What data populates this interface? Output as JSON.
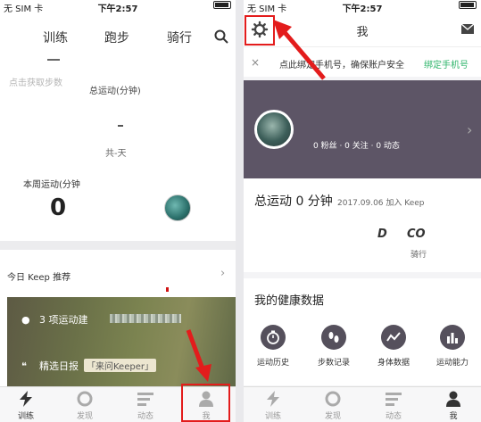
{
  "status_bar": {
    "carrier": "无 SIM 卡",
    "time": "下午2:57"
  },
  "left_screen": {
    "tabs": [
      "训练",
      "跑步",
      "骑行"
    ],
    "steps_button": "点击获取步数",
    "total_label": "总运动(分钟)",
    "days_label": "共-天",
    "week_label": "本周运动(分钟",
    "week_value": "0",
    "recommend_label": "今日 Keep 推荐",
    "banner_row1": "3 项运动建",
    "banner_row2_title": "精选日报",
    "banner_row2_chip": "「来问Keeper」",
    "tabbar": [
      "训练",
      "发现",
      "动态",
      "我"
    ]
  },
  "right_screen": {
    "title": "我",
    "notice_text": "点此绑定手机号，确保账户安全",
    "notice_link": "绑定手机号",
    "profile_stats": "0 粉丝  ·  0 关注  ·  0 动态",
    "total_sport": "总运动 0 分钟",
    "join_date": "2017.09.06 加入 Keep",
    "co_marks": [
      "D",
      "CO"
    ],
    "ride_label": "骑行",
    "health_title": "我的健康数据",
    "health_items": [
      "运动历史",
      "步数记录",
      "身体数据",
      "运动能力"
    ],
    "tabbar": [
      "训练",
      "发现",
      "动态",
      "我"
    ]
  },
  "colors": {
    "annotation_red": "#e31c1c",
    "accent_green": "#2fb56b",
    "profile_bg": "#5d5566"
  }
}
